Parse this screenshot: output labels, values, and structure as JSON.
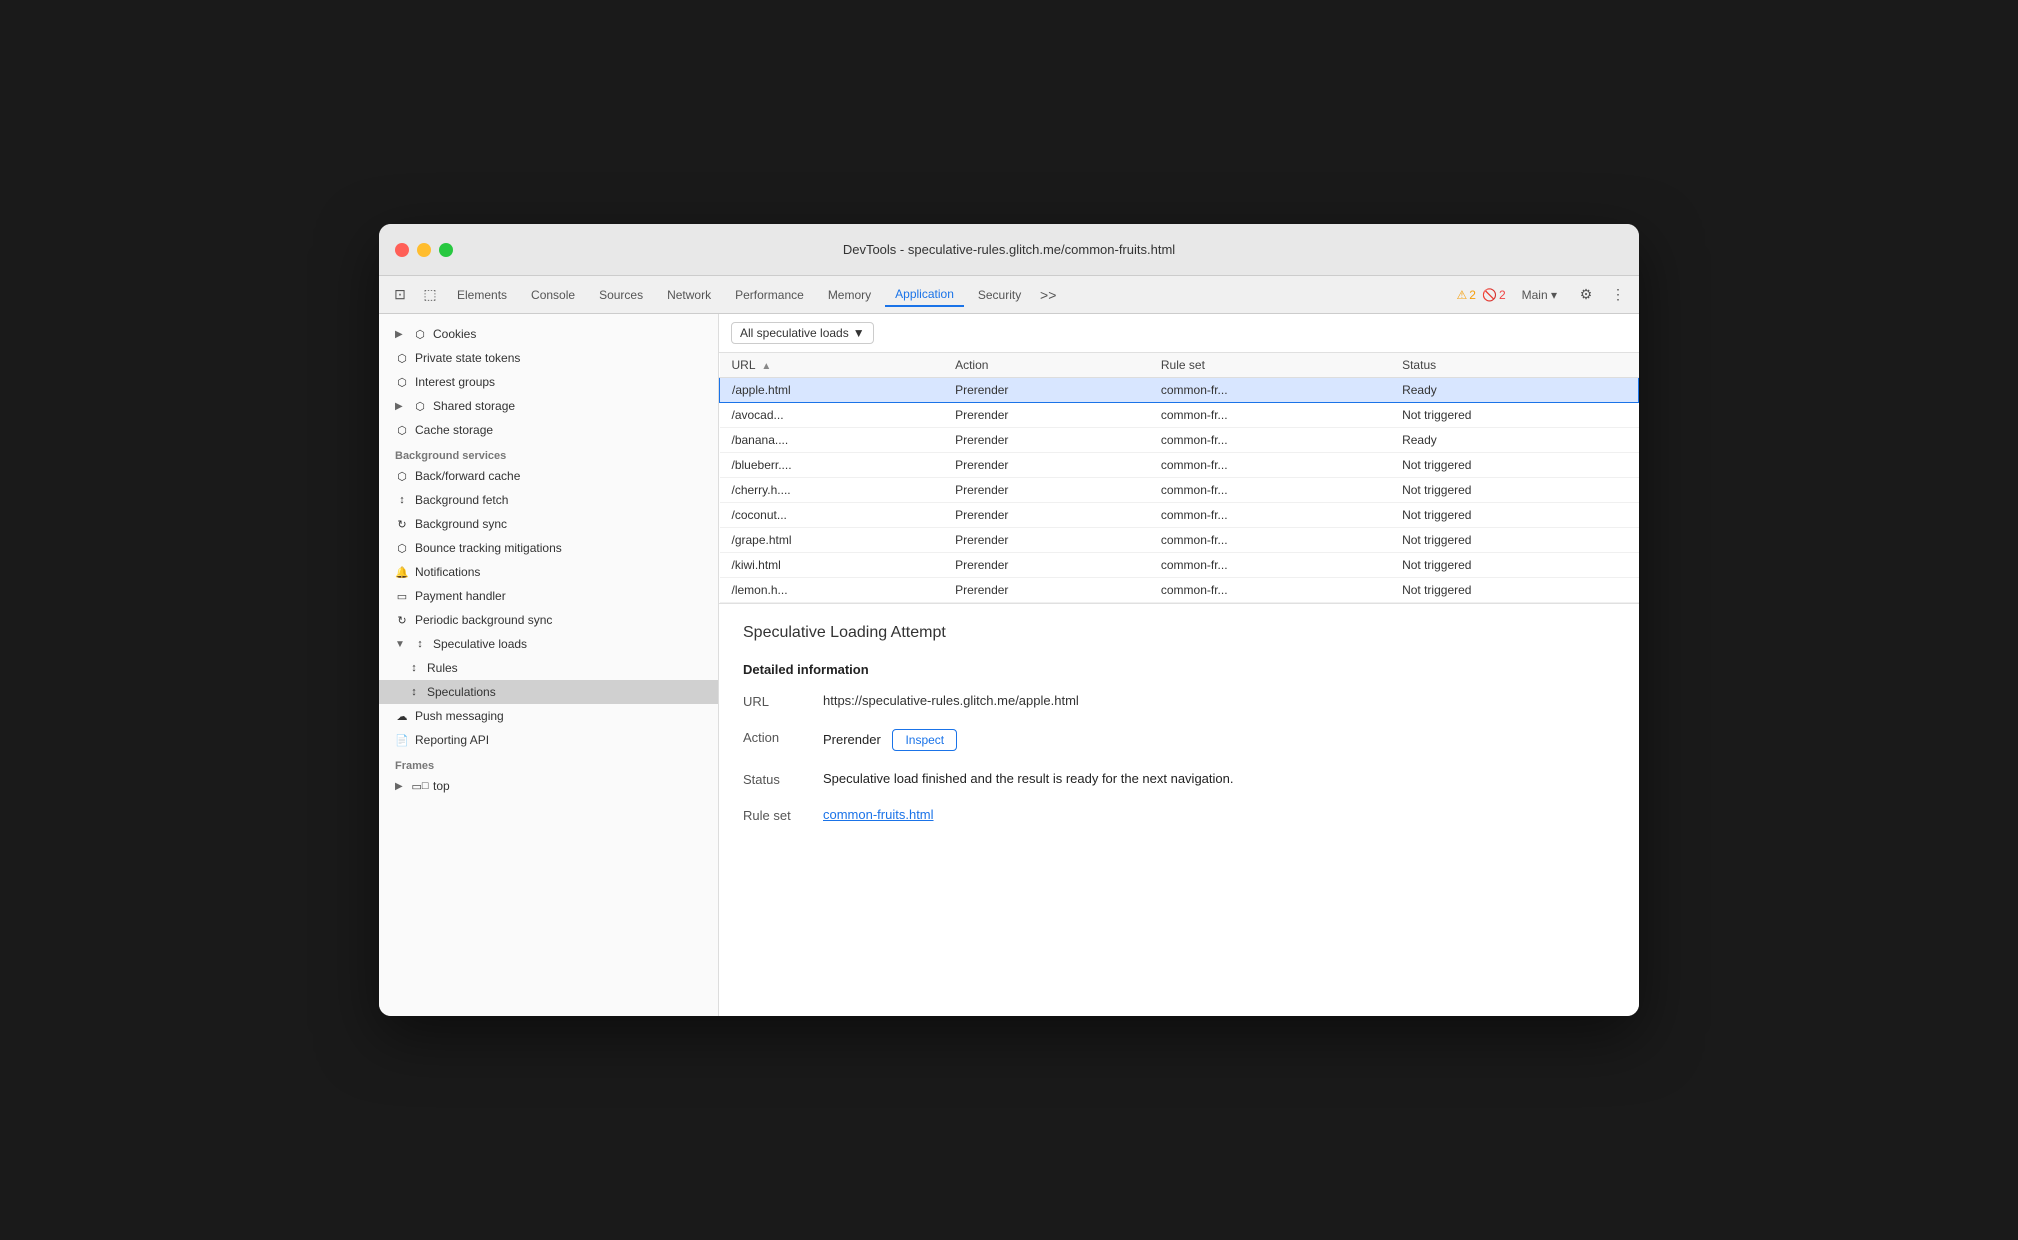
{
  "window": {
    "title": "DevTools - speculative-rules.glitch.me/common-fruits.html"
  },
  "toolbar": {
    "tabs": [
      {
        "label": "Elements",
        "active": false
      },
      {
        "label": "Console",
        "active": false
      },
      {
        "label": "Sources",
        "active": false
      },
      {
        "label": "Network",
        "active": false
      },
      {
        "label": "Performance",
        "active": false
      },
      {
        "label": "Memory",
        "active": false
      },
      {
        "label": "Application",
        "active": true
      },
      {
        "label": "Security",
        "active": false
      }
    ],
    "more_label": ">>",
    "warning_count": "2",
    "error_count": "2",
    "main_label": "Main",
    "settings_icon": "⚙",
    "more_icon": "⋮"
  },
  "sidebar": {
    "sections": {
      "storage": {
        "label": "",
        "items": [
          {
            "label": "Cookies",
            "icon": "db",
            "indent": 1,
            "expandable": true
          },
          {
            "label": "Private state tokens",
            "icon": "db",
            "indent": 1
          },
          {
            "label": "Interest groups",
            "icon": "db",
            "indent": 1
          },
          {
            "label": "Shared storage",
            "icon": "db",
            "indent": 1,
            "expandable": true
          },
          {
            "label": "Cache storage",
            "icon": "db",
            "indent": 1
          }
        ]
      },
      "background": {
        "label": "Background services",
        "items": [
          {
            "label": "Back/forward cache",
            "icon": "db",
            "indent": 1
          },
          {
            "label": "Background fetch",
            "icon": "arrow",
            "indent": 1
          },
          {
            "label": "Background sync",
            "icon": "sync",
            "indent": 1
          },
          {
            "label": "Bounce tracking mitigations",
            "icon": "db",
            "indent": 1
          },
          {
            "label": "Notifications",
            "icon": "bell",
            "indent": 1
          },
          {
            "label": "Payment handler",
            "icon": "card",
            "indent": 1
          },
          {
            "label": "Periodic background sync",
            "icon": "sync",
            "indent": 1
          },
          {
            "label": "Speculative loads",
            "icon": "arrow",
            "indent": 1,
            "expandable": true,
            "expanded": true
          },
          {
            "label": "Rules",
            "icon": "arrow",
            "indent": 2
          },
          {
            "label": "Speculations",
            "icon": "arrow",
            "indent": 2,
            "active": true
          },
          {
            "label": "Push messaging",
            "icon": "cloud",
            "indent": 1
          },
          {
            "label": "Reporting API",
            "icon": "doc",
            "indent": 1
          }
        ]
      },
      "frames": {
        "label": "Frames",
        "items": [
          {
            "label": "top",
            "icon": "frame",
            "indent": 1,
            "expandable": true
          }
        ]
      }
    }
  },
  "filter": {
    "label": "All speculative loads",
    "dropdown_icon": "▼"
  },
  "table": {
    "columns": [
      {
        "label": "URL",
        "sortable": true
      },
      {
        "label": "Action",
        "sortable": false
      },
      {
        "label": "Rule set",
        "sortable": false
      },
      {
        "label": "Status",
        "sortable": false
      }
    ],
    "rows": [
      {
        "url": "/apple.html",
        "action": "Prerender",
        "ruleset": "common-fr...",
        "status": "Ready",
        "selected": true
      },
      {
        "url": "/avocad...",
        "action": "Prerender",
        "ruleset": "common-fr...",
        "status": "Not triggered",
        "selected": false
      },
      {
        "url": "/banana....",
        "action": "Prerender",
        "ruleset": "common-fr...",
        "status": "Ready",
        "selected": false
      },
      {
        "url": "/blueberr....",
        "action": "Prerender",
        "ruleset": "common-fr...",
        "status": "Not triggered",
        "selected": false
      },
      {
        "url": "/cherry.h....",
        "action": "Prerender",
        "ruleset": "common-fr...",
        "status": "Not triggered",
        "selected": false
      },
      {
        "url": "/coconut...",
        "action": "Prerender",
        "ruleset": "common-fr...",
        "status": "Not triggered",
        "selected": false
      },
      {
        "url": "/grape.html",
        "action": "Prerender",
        "ruleset": "common-fr...",
        "status": "Not triggered",
        "selected": false
      },
      {
        "url": "/kiwi.html",
        "action": "Prerender",
        "ruleset": "common-fr...",
        "status": "Not triggered",
        "selected": false
      },
      {
        "url": "/lemon.h...",
        "action": "Prerender",
        "ruleset": "common-fr...",
        "status": "Not triggered",
        "selected": false
      }
    ]
  },
  "detail": {
    "title": "Speculative Loading Attempt",
    "section_title": "Detailed information",
    "rows": [
      {
        "label": "URL",
        "value": "https://speculative-rules.glitch.me/apple.html",
        "type": "text"
      },
      {
        "label": "Action",
        "value": "Prerender",
        "type": "action",
        "button_label": "Inspect"
      },
      {
        "label": "Status",
        "value": "Speculative load finished and the result is ready for the next navigation.",
        "type": "text"
      },
      {
        "label": "Rule set",
        "value": "common-fruits.html",
        "type": "link"
      }
    ]
  }
}
